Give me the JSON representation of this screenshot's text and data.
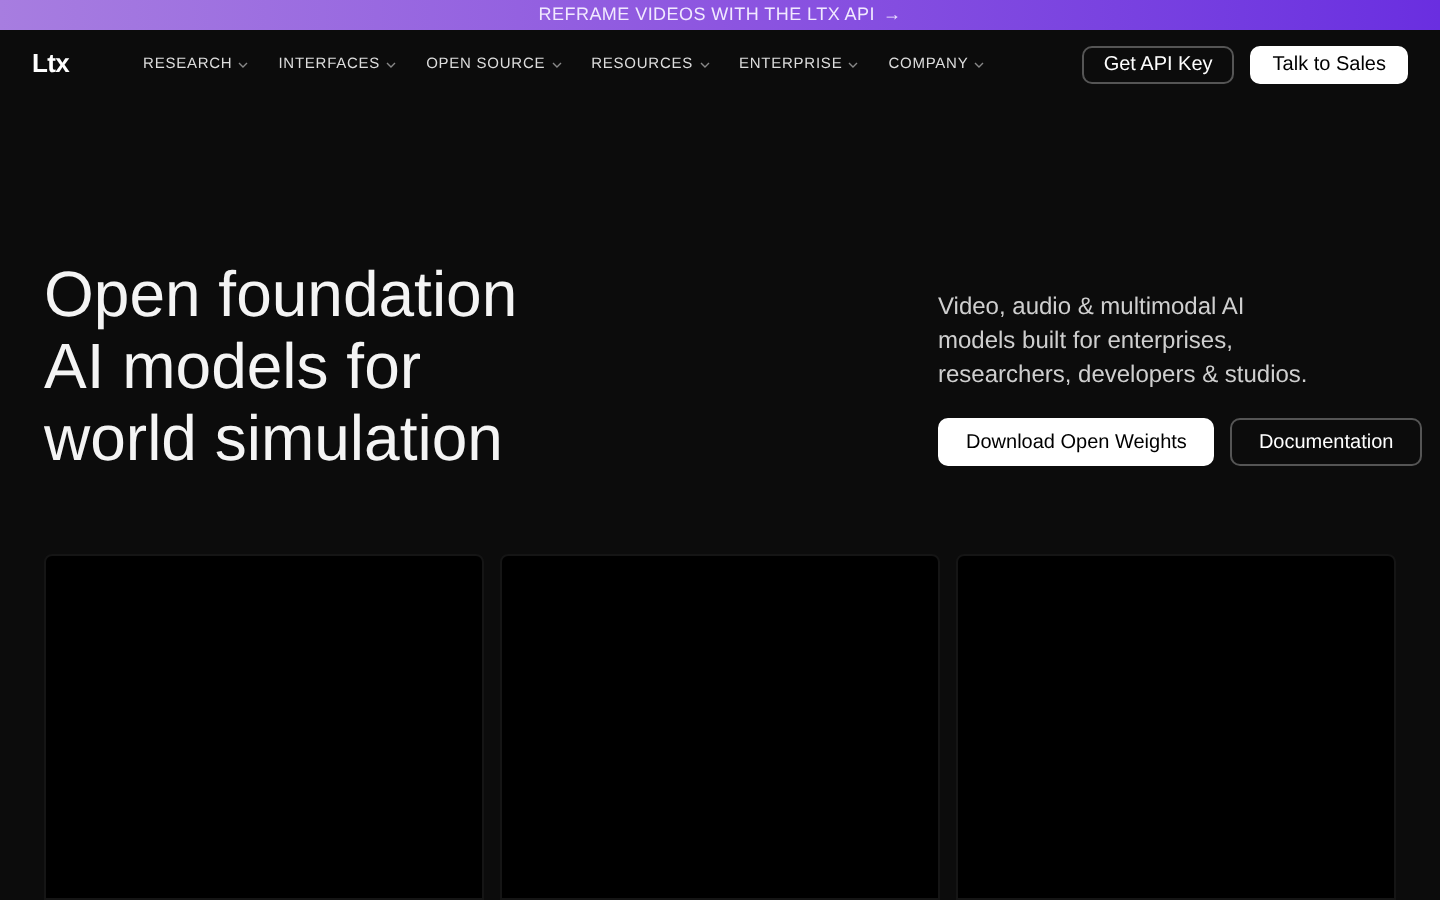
{
  "banner": {
    "text": "REFRAME VIDEOS WITH THE LTX API",
    "arrow": "→"
  },
  "nav": {
    "logo": "Ltx",
    "items": [
      {
        "label": "RESEARCH"
      },
      {
        "label": "INTERFACES"
      },
      {
        "label": "OPEN SOURCE"
      },
      {
        "label": "RESOURCES"
      },
      {
        "label": "ENTERPRISE"
      },
      {
        "label": "COMPANY"
      }
    ],
    "buttons": [
      {
        "label": "Get API Key",
        "kind": "outline"
      },
      {
        "label": "Talk to Sales",
        "kind": "solid"
      }
    ]
  },
  "hero": {
    "title_lines": [
      "Open foundation",
      "AI models for",
      "world simulation"
    ],
    "description": "Video, audio & multimodal AI models built for enterprises, researchers, developers & studios.",
    "buttons": [
      {
        "label": "Download Open Weights",
        "kind": "solid"
      },
      {
        "label": "Documentation",
        "kind": "outline"
      }
    ]
  },
  "cards": [
    {
      "kind": "video"
    },
    {
      "kind": "video"
    },
    {
      "kind": "video"
    }
  ]
}
